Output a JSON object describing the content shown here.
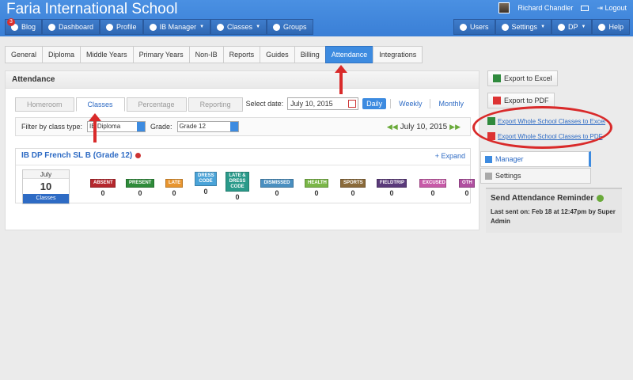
{
  "header": {
    "school": "Faria International School",
    "user_name": "Richard Chandler",
    "logout": "Logout"
  },
  "nav_left": [
    {
      "label": "Blog",
      "badge": "3"
    },
    {
      "label": "Dashboard"
    },
    {
      "label": "Profile"
    },
    {
      "label": "IB Manager"
    },
    {
      "label": "Classes"
    },
    {
      "label": "Groups"
    }
  ],
  "nav_right": [
    {
      "label": "Users"
    },
    {
      "label": "Settings"
    },
    {
      "label": "DP"
    },
    {
      "label": "Help"
    }
  ],
  "tabs": [
    "General",
    "Diploma",
    "Middle Years",
    "Primary Years",
    "Non-IB",
    "Reports",
    "Guides",
    "Billing",
    "Attendance",
    "Integrations"
  ],
  "panel": {
    "title": "Attendance",
    "subtabs": [
      "Homeroom",
      "Classes",
      "Percentage",
      "Reporting"
    ],
    "select_date_label": "Select date:",
    "date_value": "July 10, 2015",
    "views": [
      "Daily",
      "Weekly",
      "Monthly"
    ],
    "filter_label": "Filter by class type:",
    "class_type": "IB Diploma",
    "grade_label": "Grade:",
    "grade_value": "Grade 12",
    "nav_date": "July 10, 2015"
  },
  "card": {
    "title": "IB DP French SL B (Grade 12)",
    "expand": "+ Expand",
    "cal_month": "July",
    "cal_day": "10",
    "cal_caption": "Classes",
    "statuses": [
      {
        "label": "ABSENT",
        "count": "0",
        "color": "#b5272d"
      },
      {
        "label": "PRESENT",
        "count": "0",
        "color": "#2e8b3a"
      },
      {
        "label": "LATE",
        "count": "0",
        "color": "#e8952f"
      },
      {
        "label": "DRESS CODE",
        "count": "0",
        "color": "#4aa3d8"
      },
      {
        "label": "LATE & DRESS CODE",
        "count": "0",
        "color": "#2a9a8a"
      },
      {
        "label": "DISMISSED",
        "count": "0",
        "color": "#4a8fc0"
      },
      {
        "label": "HEALTH",
        "count": "0",
        "color": "#7ab648"
      },
      {
        "label": "SPORTS",
        "count": "0",
        "color": "#8a6a3a"
      },
      {
        "label": "FIELDTRIP",
        "count": "0",
        "color": "#5a3a7a"
      },
      {
        "label": "EXCUSED",
        "count": "0",
        "color": "#c75aa8"
      },
      {
        "label": "OTH",
        "count": "0",
        "color": "#b04fa0"
      }
    ]
  },
  "sidebar": {
    "export_excel": "Export to Excel",
    "export_pdf": "Export to PDF",
    "whole_excel": "Export Whole School Classes to Excel",
    "whole_pdf": "Export Whole School Classes to PDF",
    "menu_manager": "Manager",
    "menu_settings": "Settings",
    "reminder_title": "Send Attendance Reminder",
    "reminder_sent": "Last sent on: Feb 18 at 12:47pm by Super Admin"
  }
}
